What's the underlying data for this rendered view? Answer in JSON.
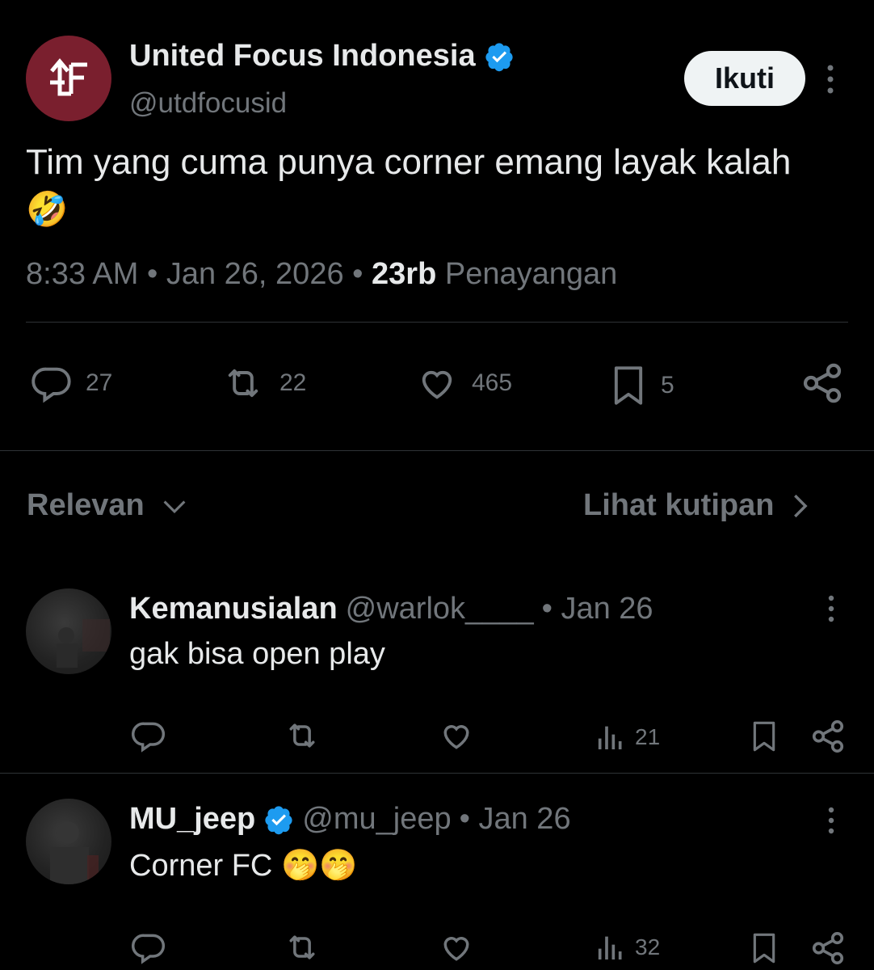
{
  "tweet": {
    "author_name": "United Focus Indonesia",
    "author_handle": "@utdfocusid",
    "follow_label": "Ikuti",
    "text": "Tim yang cuma punya corner emang layak kalah",
    "emoji": "🤣",
    "time": "8:33 AM",
    "date": "Jan 26, 2026",
    "views": "23rb",
    "views_label": "Penayangan",
    "stats": {
      "replies": "27",
      "retweets": "22",
      "likes": "465",
      "bookmarks": "5"
    }
  },
  "sort": {
    "label": "Relevan",
    "quotes_label": "Lihat kutipan"
  },
  "replies": [
    {
      "name": "Kemanusialan",
      "handle": "@warlok____",
      "date": "• Jan 26",
      "text": "gak bisa open play",
      "views": "21",
      "verified": false
    },
    {
      "name": "MU_jeep",
      "handle": "@mu_jeep",
      "date": "• Jan 26",
      "text": "Corner FC",
      "emoji": "🤭🤭",
      "views": "32",
      "verified": true
    }
  ],
  "colors": {
    "background": "#000000",
    "muted": "#71767b",
    "text": "#e7e9ea",
    "verified": "#1d9bf0",
    "avatar": "#7a1f2e"
  },
  "icons": [
    "more-icon",
    "verified-icon",
    "reply-icon",
    "retweet-icon",
    "like-icon",
    "bookmark-icon",
    "share-icon",
    "chevron-down-icon",
    "chevron-right-icon",
    "views-icon"
  ]
}
